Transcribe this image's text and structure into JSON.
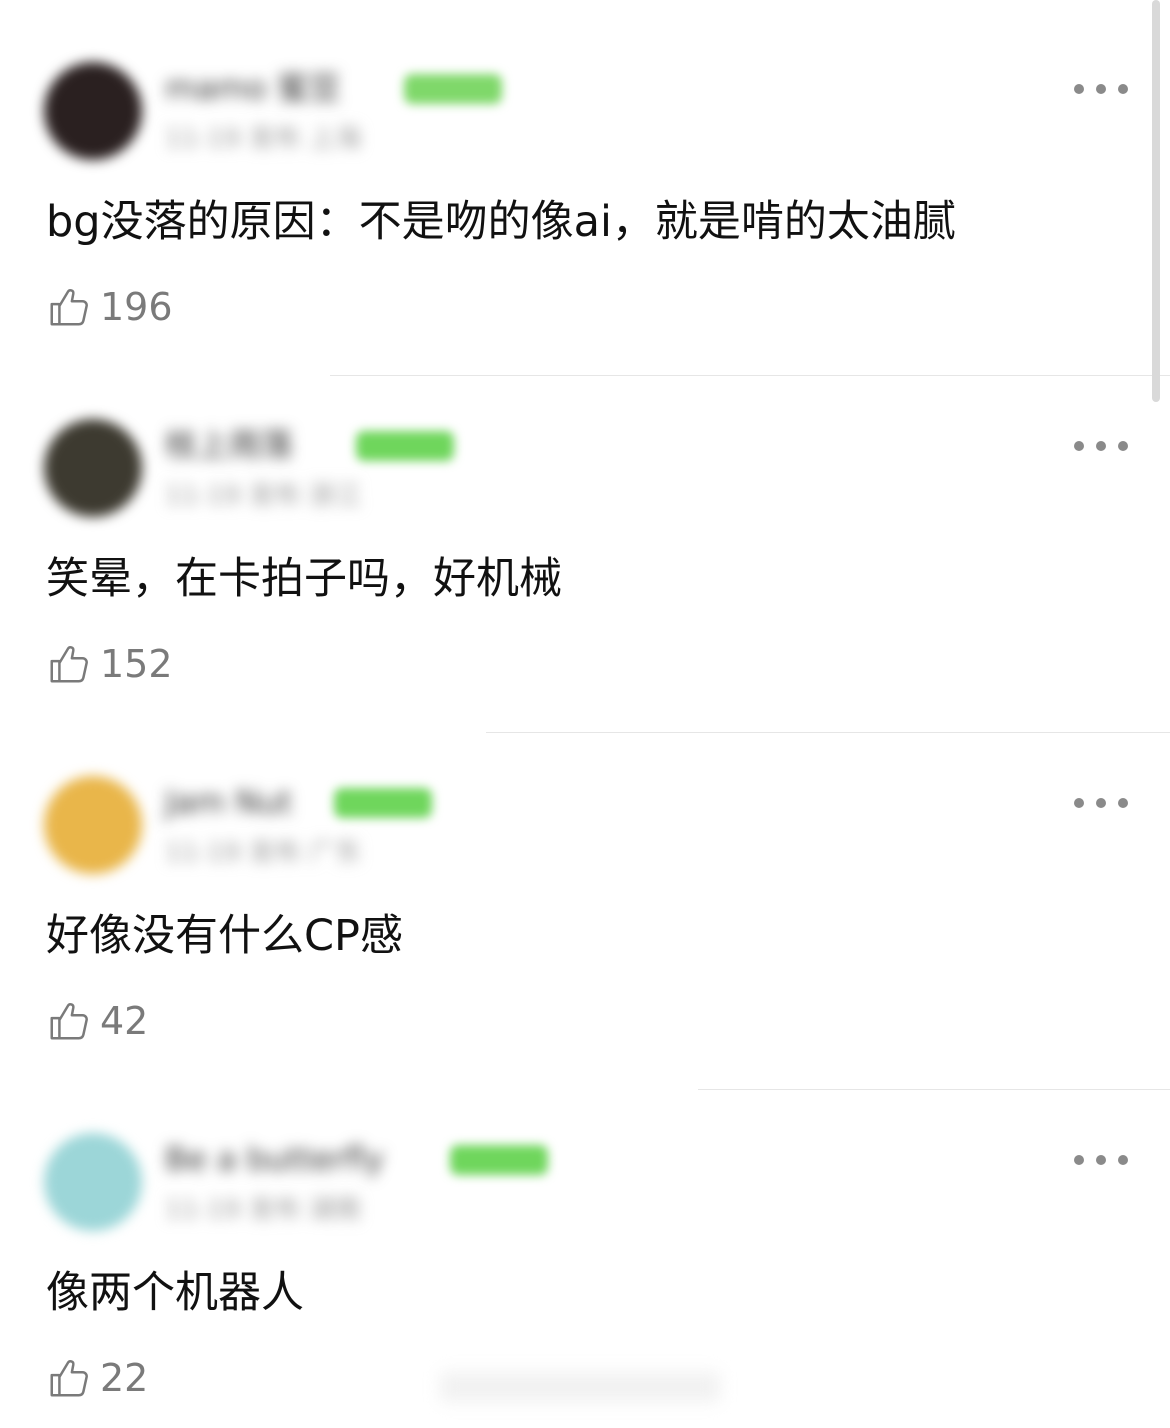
{
  "comments": [
    {
      "username": "mamo 蜜豆",
      "meta": "11-19 发布 上海",
      "text": "bg没落的原因：不是吻的像ai，就是啃的太油腻",
      "likes": "196",
      "avatar_color": "#2a2020",
      "badge_color": "#7fd86a"
    },
    {
      "username": "枝上雨落",
      "meta": "11-19 发布 浙江",
      "text": "笑晕，在卡拍子吗，好机械",
      "likes": "152",
      "avatar_color": "#3d3a30",
      "badge_color": "#6fd65c"
    },
    {
      "username": "Jam Nut",
      "meta": "11-19 发布 广东",
      "text": "好像没有什么CP感",
      "likes": "42",
      "avatar_color": "#e9b64a",
      "badge_color": "#6fd65c"
    },
    {
      "username": "Be a butterfly",
      "meta": "11-19 发布 湖南",
      "text": "像两个机器人",
      "likes": "22",
      "avatar_color": "#9cd6d8",
      "badge_color": "#6fd65c"
    }
  ],
  "icons": {
    "like": "thumbs-up-outline-icon",
    "more": "more-dots-icon"
  },
  "colors": {
    "background": "#ffffff",
    "text": "#111111",
    "muted": "#7a7a7a",
    "divider": "#e6e6e6"
  }
}
